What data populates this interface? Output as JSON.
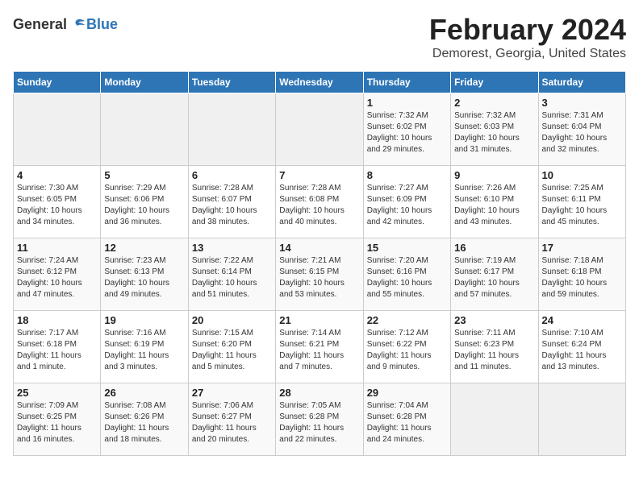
{
  "logo": {
    "general": "General",
    "blue": "Blue"
  },
  "header": {
    "title": "February 2024",
    "subtitle": "Demorest, Georgia, United States"
  },
  "weekdays": [
    "Sunday",
    "Monday",
    "Tuesday",
    "Wednesday",
    "Thursday",
    "Friday",
    "Saturday"
  ],
  "weeks": [
    [
      {
        "day": "",
        "info": ""
      },
      {
        "day": "",
        "info": ""
      },
      {
        "day": "",
        "info": ""
      },
      {
        "day": "",
        "info": ""
      },
      {
        "day": "1",
        "info": "Sunrise: 7:32 AM\nSunset: 6:02 PM\nDaylight: 10 hours\nand 29 minutes."
      },
      {
        "day": "2",
        "info": "Sunrise: 7:32 AM\nSunset: 6:03 PM\nDaylight: 10 hours\nand 31 minutes."
      },
      {
        "day": "3",
        "info": "Sunrise: 7:31 AM\nSunset: 6:04 PM\nDaylight: 10 hours\nand 32 minutes."
      }
    ],
    [
      {
        "day": "4",
        "info": "Sunrise: 7:30 AM\nSunset: 6:05 PM\nDaylight: 10 hours\nand 34 minutes."
      },
      {
        "day": "5",
        "info": "Sunrise: 7:29 AM\nSunset: 6:06 PM\nDaylight: 10 hours\nand 36 minutes."
      },
      {
        "day": "6",
        "info": "Sunrise: 7:28 AM\nSunset: 6:07 PM\nDaylight: 10 hours\nand 38 minutes."
      },
      {
        "day": "7",
        "info": "Sunrise: 7:28 AM\nSunset: 6:08 PM\nDaylight: 10 hours\nand 40 minutes."
      },
      {
        "day": "8",
        "info": "Sunrise: 7:27 AM\nSunset: 6:09 PM\nDaylight: 10 hours\nand 42 minutes."
      },
      {
        "day": "9",
        "info": "Sunrise: 7:26 AM\nSunset: 6:10 PM\nDaylight: 10 hours\nand 43 minutes."
      },
      {
        "day": "10",
        "info": "Sunrise: 7:25 AM\nSunset: 6:11 PM\nDaylight: 10 hours\nand 45 minutes."
      }
    ],
    [
      {
        "day": "11",
        "info": "Sunrise: 7:24 AM\nSunset: 6:12 PM\nDaylight: 10 hours\nand 47 minutes."
      },
      {
        "day": "12",
        "info": "Sunrise: 7:23 AM\nSunset: 6:13 PM\nDaylight: 10 hours\nand 49 minutes."
      },
      {
        "day": "13",
        "info": "Sunrise: 7:22 AM\nSunset: 6:14 PM\nDaylight: 10 hours\nand 51 minutes."
      },
      {
        "day": "14",
        "info": "Sunrise: 7:21 AM\nSunset: 6:15 PM\nDaylight: 10 hours\nand 53 minutes."
      },
      {
        "day": "15",
        "info": "Sunrise: 7:20 AM\nSunset: 6:16 PM\nDaylight: 10 hours\nand 55 minutes."
      },
      {
        "day": "16",
        "info": "Sunrise: 7:19 AM\nSunset: 6:17 PM\nDaylight: 10 hours\nand 57 minutes."
      },
      {
        "day": "17",
        "info": "Sunrise: 7:18 AM\nSunset: 6:18 PM\nDaylight: 10 hours\nand 59 minutes."
      }
    ],
    [
      {
        "day": "18",
        "info": "Sunrise: 7:17 AM\nSunset: 6:18 PM\nDaylight: 11 hours\nand 1 minute."
      },
      {
        "day": "19",
        "info": "Sunrise: 7:16 AM\nSunset: 6:19 PM\nDaylight: 11 hours\nand 3 minutes."
      },
      {
        "day": "20",
        "info": "Sunrise: 7:15 AM\nSunset: 6:20 PM\nDaylight: 11 hours\nand 5 minutes."
      },
      {
        "day": "21",
        "info": "Sunrise: 7:14 AM\nSunset: 6:21 PM\nDaylight: 11 hours\nand 7 minutes."
      },
      {
        "day": "22",
        "info": "Sunrise: 7:12 AM\nSunset: 6:22 PM\nDaylight: 11 hours\nand 9 minutes."
      },
      {
        "day": "23",
        "info": "Sunrise: 7:11 AM\nSunset: 6:23 PM\nDaylight: 11 hours\nand 11 minutes."
      },
      {
        "day": "24",
        "info": "Sunrise: 7:10 AM\nSunset: 6:24 PM\nDaylight: 11 hours\nand 13 minutes."
      }
    ],
    [
      {
        "day": "25",
        "info": "Sunrise: 7:09 AM\nSunset: 6:25 PM\nDaylight: 11 hours\nand 16 minutes."
      },
      {
        "day": "26",
        "info": "Sunrise: 7:08 AM\nSunset: 6:26 PM\nDaylight: 11 hours\nand 18 minutes."
      },
      {
        "day": "27",
        "info": "Sunrise: 7:06 AM\nSunset: 6:27 PM\nDaylight: 11 hours\nand 20 minutes."
      },
      {
        "day": "28",
        "info": "Sunrise: 7:05 AM\nSunset: 6:28 PM\nDaylight: 11 hours\nand 22 minutes."
      },
      {
        "day": "29",
        "info": "Sunrise: 7:04 AM\nSunset: 6:28 PM\nDaylight: 11 hours\nand 24 minutes."
      },
      {
        "day": "",
        "info": ""
      },
      {
        "day": "",
        "info": ""
      }
    ]
  ]
}
